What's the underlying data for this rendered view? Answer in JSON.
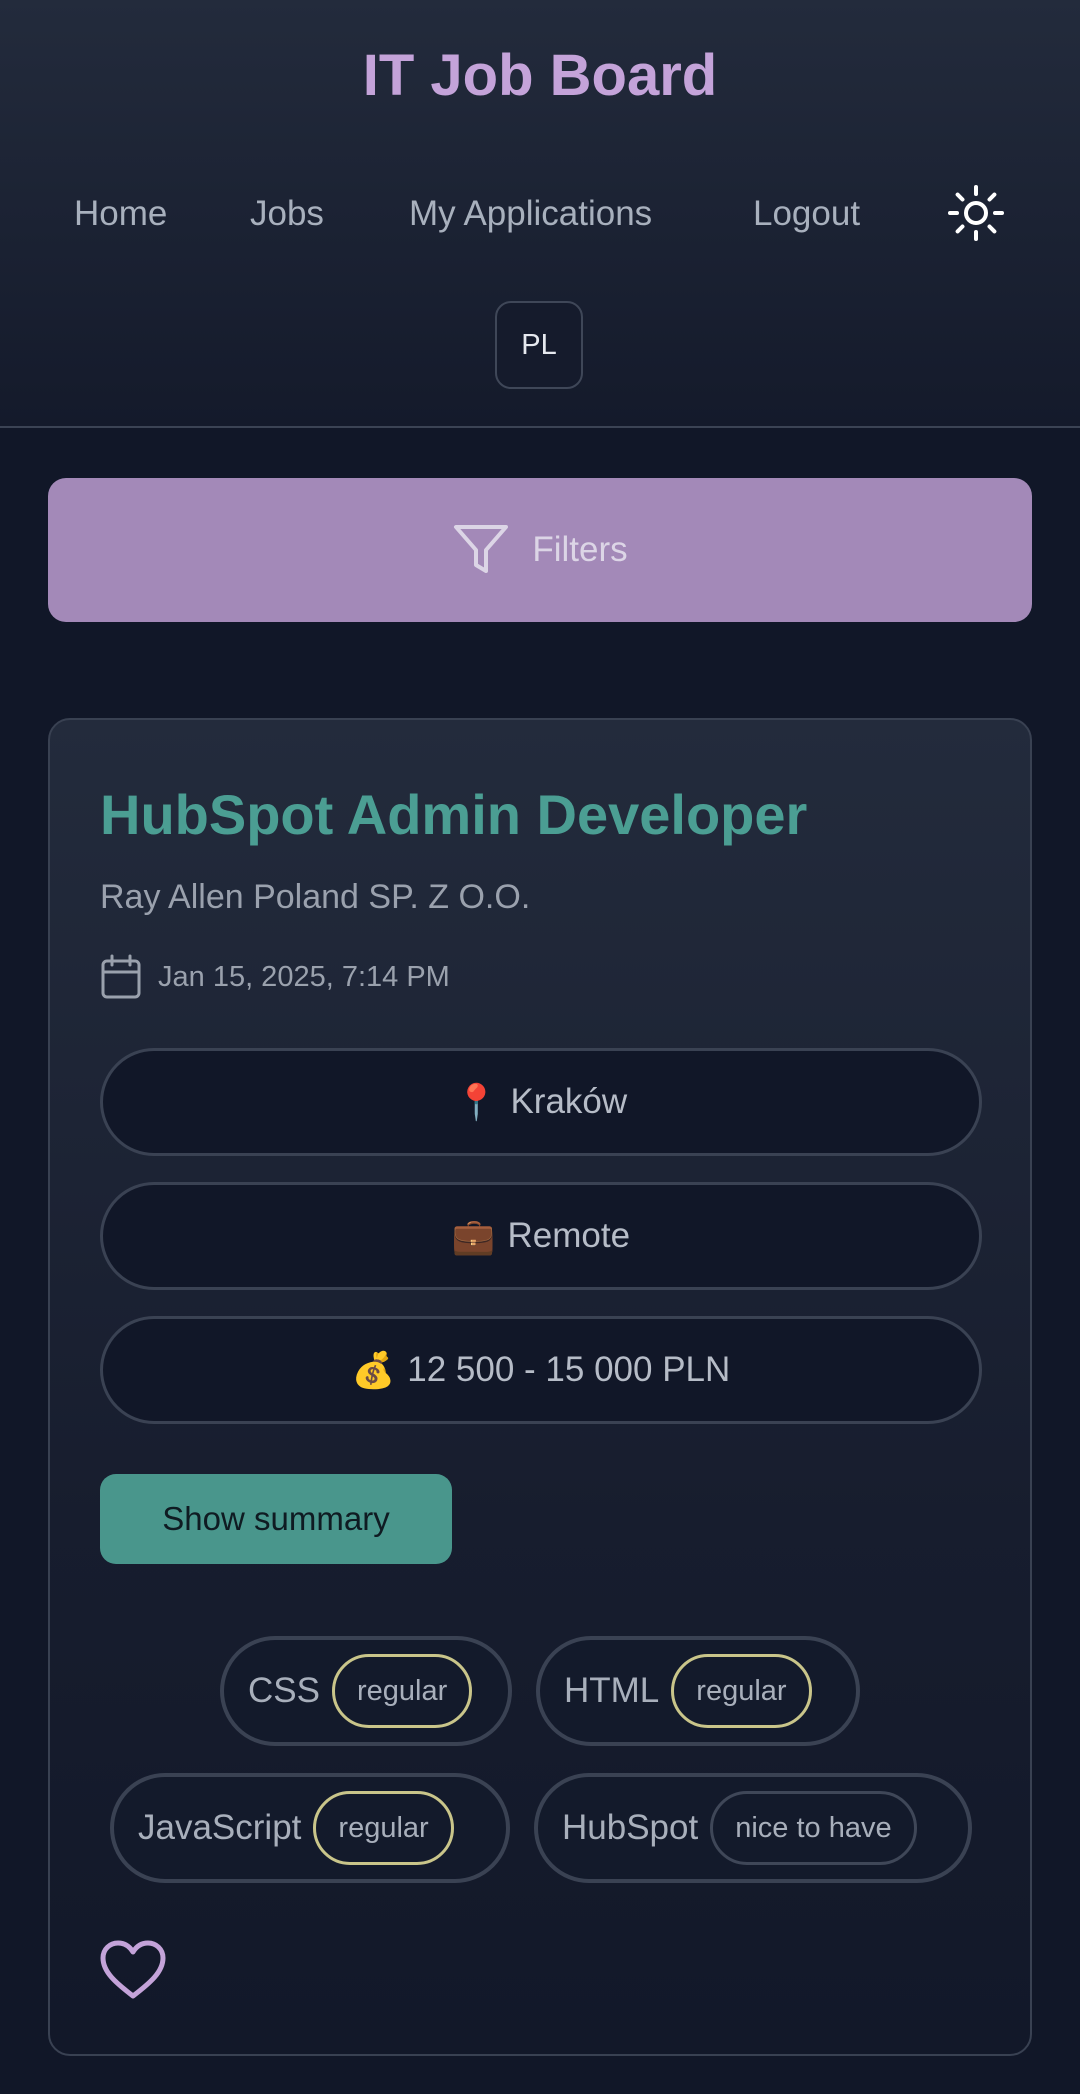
{
  "header": {
    "title": "IT Job Board",
    "nav": [
      "Home",
      "Jobs",
      "My Applications",
      "Logout"
    ],
    "theme_icon": "sun-icon",
    "language": "PL"
  },
  "filters": {
    "label": "Filters",
    "icon": "funnel-icon"
  },
  "job": {
    "title": "HubSpot Admin Developer",
    "company": "Ray Allen Poland SP. Z O.O.",
    "date": "Jan 15, 2025, 7:14 PM",
    "location": {
      "emoji": "📍",
      "text": "Kraków"
    },
    "work_mode": {
      "emoji": "💼",
      "text": "Remote"
    },
    "salary": {
      "emoji": "💰",
      "text": "12 500 - 15 000 PLN"
    },
    "summary_button": "Show summary",
    "skills": [
      {
        "name": "CSS",
        "level": "regular"
      },
      {
        "name": "HTML",
        "level": "regular"
      },
      {
        "name": "JavaScript",
        "level": "regular"
      },
      {
        "name": "HubSpot",
        "level": "nice to have"
      }
    ],
    "favorite_icon": "heart-icon"
  },
  "colors": {
    "accent_purple": "#c4a3d9",
    "filters_bg": "#a389b8",
    "title_teal": "#4b9e93",
    "button_teal": "#49968c",
    "level_border": "#c9c58a",
    "background": "#111728"
  }
}
